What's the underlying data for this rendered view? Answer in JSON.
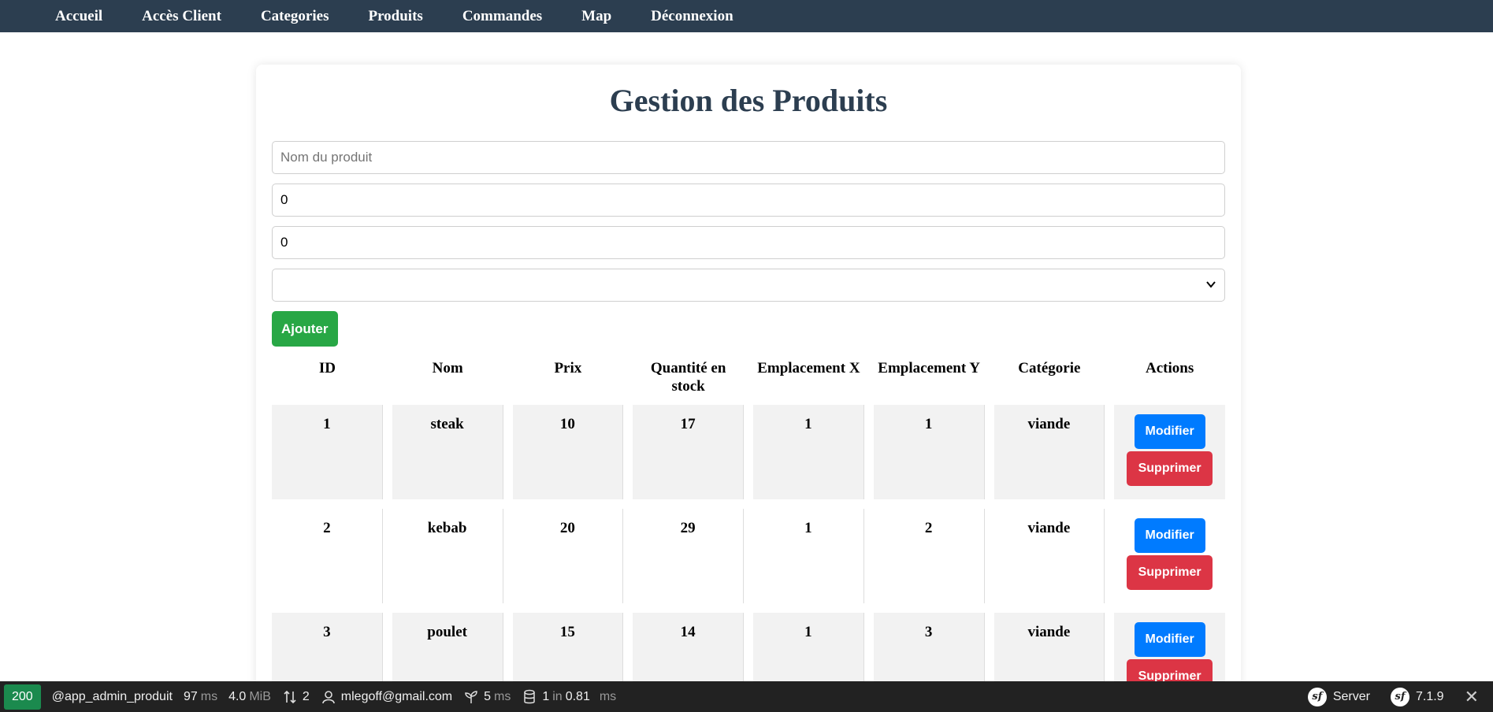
{
  "nav": {
    "items": [
      "Accueil",
      "Accès Client",
      "Categories",
      "Produits",
      "Commandes",
      "Map",
      "Déconnexion"
    ]
  },
  "page": {
    "title": "Gestion des Produits"
  },
  "form": {
    "name_placeholder": "Nom du produit",
    "price_value": "0",
    "stock_value": "0",
    "category_value": "",
    "add_label": "Ajouter"
  },
  "table": {
    "headers": [
      "ID",
      "Nom",
      "Prix",
      "Quantité en stock",
      "Emplacement X",
      "Emplacement Y",
      "Catégorie",
      "Actions"
    ],
    "rows": [
      {
        "id": "1",
        "nom": "steak",
        "prix": "10",
        "stock": "17",
        "x": "1",
        "y": "1",
        "categorie": "viande"
      },
      {
        "id": "2",
        "nom": "kebab",
        "prix": "20",
        "stock": "29",
        "x": "1",
        "y": "2",
        "categorie": "viande"
      },
      {
        "id": "3",
        "nom": "poulet",
        "prix": "15",
        "stock": "14",
        "x": "1",
        "y": "3",
        "categorie": "viande"
      }
    ],
    "edit_label": "Modifier",
    "delete_label": "Supprimer"
  },
  "toolbar": {
    "status_code": "200",
    "route": "@app_admin_produit",
    "time_value": "97",
    "time_unit": "ms",
    "memory_value": "4.0",
    "memory_unit": "MiB",
    "requests_count": "2",
    "user": "mlegoff@gmail.com",
    "twig_value": "5",
    "twig_unit": "ms",
    "db_queries": "1",
    "db_in": "in",
    "db_time": "0.81",
    "db_unit": "ms",
    "server_label": "Server",
    "version": "7.1.9",
    "icons": [
      "arrows-updown-icon",
      "user-icon",
      "leaf-icon",
      "database-icon",
      "symfony-logo",
      "close-icon"
    ]
  },
  "colors": {
    "navbar": "#2c3e50",
    "title": "#2c3e50",
    "add_button": "#28a745",
    "edit_button": "#007bff",
    "delete_button": "#dc3545",
    "status_ok": "#1b8a4e",
    "toolbar": "#222222"
  }
}
